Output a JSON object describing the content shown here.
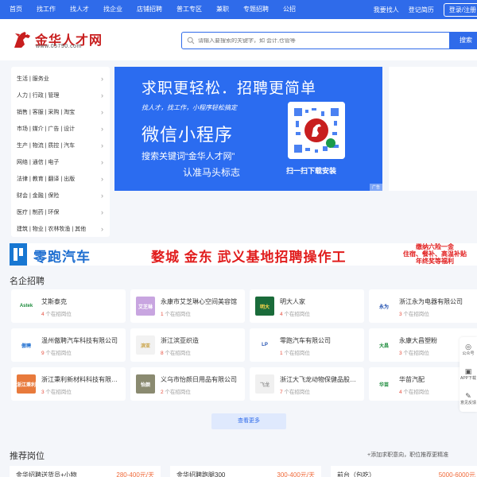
{
  "topnav": {
    "links": [
      "首页",
      "找工作",
      "找人才",
      "找企业",
      "店铺招聘",
      "普工专区",
      "兼职",
      "专题招聘",
      "公招"
    ],
    "login_label": "我要找人",
    "company_login": "登记简历",
    "register_label": "登录/注册"
  },
  "header": {
    "logo_name": "金华人才网",
    "logo_url": "www.05790.com",
    "search_placeholder": "请输入要搜索的关键字，如 会计,仓管等",
    "search_button": "搜索"
  },
  "categories": [
    "生活 | 服务业",
    "人力 | 行政 | 管理",
    "销售 | 客服 | 采购 | 淘宝",
    "市场 | 媒介 | 广告 | 设计",
    "生产 | 物流 | 质控 | 汽车",
    "网络 | 通信 | 电子",
    "法律 | 教育 | 翻译 | 出版",
    "财会 | 金融 | 保险",
    "医疗 | 制药 | 环保",
    "建筑 | 物业 | 农林牧渔 | 其他"
  ],
  "banner": {
    "headline": "求职更轻松．招聘更简单",
    "subline": "找人才，找工作，小程序轻松搞定",
    "mini_program": "微信小程序",
    "search_hint": "搜索关键词“金华人才网”",
    "mark_hint": "认准马头标志",
    "qr_caption": "扫一扫下载安装",
    "ad_tag": "广告"
  },
  "strip": {
    "brand": "零跑汽车",
    "campaign": "婺城 金东 武义基地招聘操作工",
    "benefits": [
      "缴纳六险一金",
      "住宿、餐补、高温补贴",
      "年终奖等福利"
    ]
  },
  "famous": {
    "title": "名企招聘",
    "more_button": "查看更多",
    "companies": [
      {
        "name": "艾斯泰克",
        "jobs": "4",
        "suffix": " 个在招岗位",
        "logo_text": "Astek",
        "logo_color": "#ffffff",
        "logo_fg": "#1a8a3a"
      },
      {
        "name": "永康市艾芝琳心空间美容馆",
        "jobs": "1",
        "suffix": " 个在招岗位",
        "logo_text": "艾芝琳",
        "logo_color": "#c8a5e0",
        "logo_fg": "#ffffff"
      },
      {
        "name": "明大人家",
        "jobs": "4",
        "suffix": " 个在招岗位",
        "logo_text": "明大",
        "logo_color": "#1a6b3a",
        "logo_fg": "#ffd84a"
      },
      {
        "name": "浙江永为电器有限公司",
        "jobs": "3",
        "suffix": " 个在招岗位",
        "logo_text": "永为",
        "logo_color": "#ffffff",
        "logo_fg": "#1f4fb0"
      },
      {
        "name": "温州傲聘汽车科技有限公司",
        "jobs": "9",
        "suffix": " 个在招岗位",
        "logo_text": "傲聘",
        "logo_color": "#ffffff",
        "logo_fg": "#1f6fd0"
      },
      {
        "name": "浙江滨亚织造",
        "jobs": "8",
        "suffix": " 个在招岗位",
        "logo_text": "滨亚",
        "logo_color": "#f2f2f2",
        "logo_fg": "#c8a040"
      },
      {
        "name": "零跑汽车有限公司",
        "jobs": "1",
        "suffix": " 个在招岗位",
        "logo_text": "LP",
        "logo_color": "#ffffff",
        "logo_fg": "#1f4fb0"
      },
      {
        "name": "永康大昌塑粉",
        "jobs": "3",
        "suffix": " 个在招岗位",
        "logo_text": "大昌",
        "logo_color": "#ffffff",
        "logo_fg": "#1a8a3a"
      },
      {
        "name": "浙江秉利新材料科技有限公司",
        "jobs": "3",
        "suffix": " 个在招岗位",
        "logo_text": "浙江秉利",
        "logo_color": "#e87a3c",
        "logo_fg": "#ffffff"
      },
      {
        "name": "义乌市怡颜日用品有限公司",
        "jobs": "2",
        "suffix": " 个在招岗位",
        "logo_text": "怡颜",
        "logo_color": "#8a8a70",
        "logo_fg": "#ffffff"
      },
      {
        "name": "浙江大飞龙动物保健品股份有限公司",
        "jobs": "7",
        "suffix": " 个在招岗位",
        "logo_text": "飞龙",
        "logo_color": "#f0f0f0",
        "logo_fg": "#999999"
      },
      {
        "name": "华苗汽配",
        "jobs": "4",
        "suffix": " 个在招岗位",
        "logo_text": "华苗",
        "logo_color": "#ffffff",
        "logo_fg": "#1a8a3a"
      }
    ]
  },
  "floatbar": [
    "公众号",
    "APP下载",
    "意见反馈"
  ],
  "recommend": {
    "title": "推荐岗位",
    "right_text": "+添加求职意向，职位推荐更精准",
    "jobs": [
      {
        "title": "金华招聘送货员+小物",
        "salary": "280-400元/天"
      },
      {
        "title": "金华招聘跑腿300",
        "salary": "300-400元/天"
      },
      {
        "title": "前台（包吃）",
        "salary": "5000-6000元"
      }
    ]
  },
  "colors": {
    "brand_blue": "#2f6bea",
    "salary_orange": "#f06a3a",
    "logo_red": "#c81e1e"
  }
}
